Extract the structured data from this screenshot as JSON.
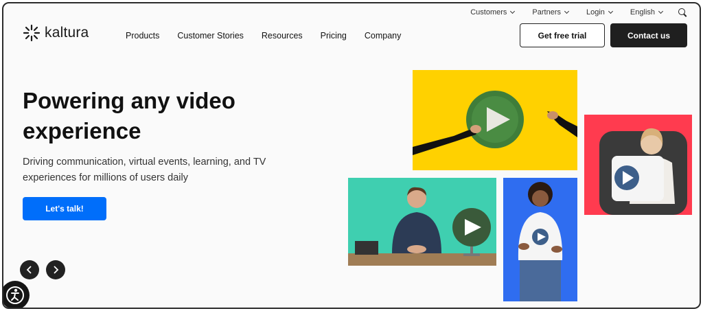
{
  "utility_nav": {
    "items": [
      "Customers",
      "Partners",
      "Login",
      "English"
    ]
  },
  "brand": {
    "name": "kaltura"
  },
  "main_nav": {
    "items": [
      "Products",
      "Customer Stories",
      "Resources",
      "Pricing",
      "Company"
    ]
  },
  "header_actions": {
    "trial_label": "Get free trial",
    "contact_label": "Contact us"
  },
  "hero": {
    "title": "Powering any video experience",
    "subtitle": "Driving communication, virtual events, learning, and TV experiences for millions of users daily",
    "cta_label": "Let's talk!"
  },
  "colors": {
    "cta_blue": "#006efa",
    "tile_yellow": "#ffd100",
    "tile_teal": "#3fcfb0",
    "tile_blue": "#2f6df0",
    "tile_red": "#ff3b4f",
    "dark": "#1f1f1f"
  },
  "icons": {
    "search": "search-icon",
    "logo": "kaltura-logo-icon",
    "prev": "chevron-left-icon",
    "next": "chevron-right-icon",
    "accessibility": "accessibility-icon"
  }
}
